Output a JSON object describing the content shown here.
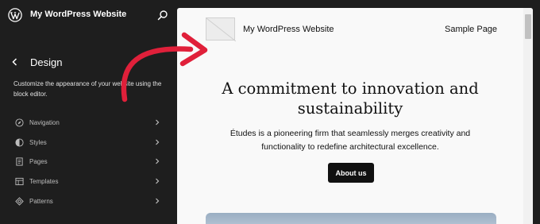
{
  "topbar": {
    "site_title": "My WordPress Website",
    "logo_icon": "wordpress-logo-icon",
    "search_icon": "search-icon"
  },
  "sidebar": {
    "title": "Design",
    "description": "Customize the appearance of your website using the block editor.",
    "items": [
      {
        "label": "Navigation",
        "icon": "navigation-icon"
      },
      {
        "label": "Styles",
        "icon": "styles-icon"
      },
      {
        "label": "Pages",
        "icon": "pages-icon"
      },
      {
        "label": "Templates",
        "icon": "templates-icon"
      },
      {
        "label": "Patterns",
        "icon": "patterns-icon"
      }
    ]
  },
  "preview": {
    "site_title": "My WordPress Website",
    "nav_link": "Sample Page",
    "hero_title": "A commitment to innovation and sustainability",
    "hero_text": "Études is a pioneering firm that seamlessly merges creativity and functionality to redefine architectural excellence.",
    "cta_label": "About us"
  },
  "colors": {
    "sidebar_bg": "#1e1e1e",
    "arrow": "#e0203a",
    "canvas_bg": "#f9f9f9",
    "button_bg": "#111111"
  }
}
